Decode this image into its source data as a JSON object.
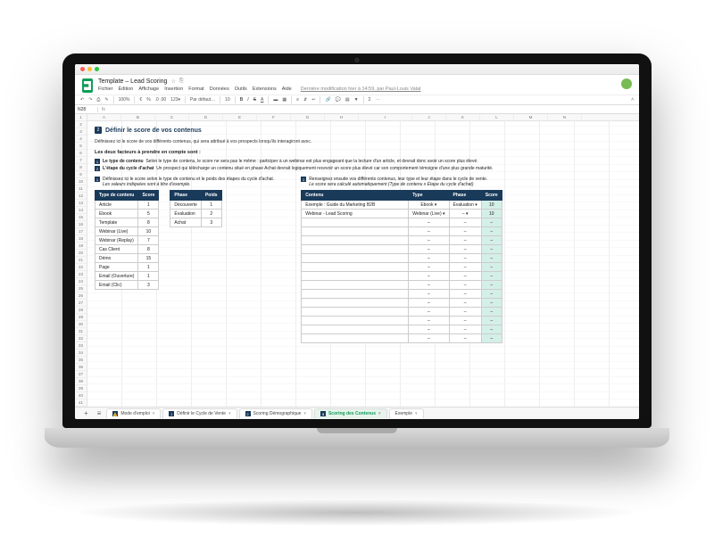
{
  "doc": {
    "title": "Template – Lead Scoring",
    "star_icon": "☆",
    "folder_icon": "⎘",
    "last_edit": "Dernière modification hier à 14:59, par Paul-Louis Valat",
    "namebox": "N28"
  },
  "menus": [
    "Fichier",
    "Édition",
    "Affichage",
    "Insertion",
    "Format",
    "Données",
    "Outils",
    "Extensions",
    "Aide"
  ],
  "toolbar": {
    "zoom": "100%",
    "currency": "€",
    "percent": "%",
    "decimals": ".0  .00",
    "format_menu": "123▾",
    "font": "Par défaut…",
    "font_size": "10",
    "bold": "B",
    "italic": "I",
    "strike": "S",
    "underline": "A"
  },
  "columns": [
    "A",
    "B",
    "C",
    "D",
    "E",
    "F",
    "G",
    "H",
    "I",
    "J",
    "K",
    "L",
    "M",
    "N"
  ],
  "section": {
    "badge": "2",
    "title": "Définir le score de vos contenus",
    "intro": "Définissez ici le score de vos différents contenus, qui sera attribué à vos prospects lorsqu'ils interagiront avec.",
    "subheading": "Les deux facteurs à prendre en compte sont :",
    "bullets": [
      {
        "n": "1",
        "b": "Le type de contenu",
        "t": "Selon le type de contenu, le score ne sera pas le même : participer à un webinar est plus engageant que la lecture d'un article, et devrait donc avoir un score plus élevé."
      },
      {
        "n": "2",
        "b": "L'étape du cycle d'achat",
        "t": "Un prospect qui télécharge un contenu situé en phase Achat devrait logiquement recevoir un score plus élevé car son comportement témoigne d'une plus grande maturité."
      }
    ],
    "left_panel": {
      "n": "1",
      "line1": "Définissez ici le score selon le type de contenu et le poids des étapes du cycle d'achat.",
      "line2": "Les valeurs indiquées sont à titre d'exemple."
    },
    "right_panel": {
      "n": "2",
      "line1": "Renseignez ensuite vos différents contenus, leur type et leur étape dans le cycle de vente.",
      "line2": "Le score sera calculé automatiquement (Type de contenu x Étape du cycle d'achat)"
    }
  },
  "table_type": {
    "headers": [
      "Type de contenu",
      "Score"
    ],
    "rows": [
      [
        "Article",
        "1"
      ],
      [
        "Ebook",
        "5"
      ],
      [
        "Template",
        "8"
      ],
      [
        "Webinar (Live)",
        "10"
      ],
      [
        "Webinar (Replay)",
        "7"
      ],
      [
        "Cas Client",
        "8"
      ],
      [
        "Démo",
        "15"
      ],
      [
        "Page",
        "1"
      ],
      [
        "Email (Ouverture)",
        "1"
      ],
      [
        "Email (Clic)",
        "3"
      ]
    ]
  },
  "table_phase": {
    "headers": [
      "Phase",
      "Poids"
    ],
    "rows": [
      [
        "Découverte",
        "1"
      ],
      [
        "Évaluation",
        "2"
      ],
      [
        "Achat",
        "3"
      ]
    ]
  },
  "table_content": {
    "headers": [
      "Contenu",
      "Type",
      "Phase",
      "Score"
    ],
    "rows": [
      [
        "Exemple : Guide du Marketing B2B",
        "Ebook ▾",
        "Évaluation ▾",
        "10"
      ],
      [
        "Webinar - Lead Scoring",
        "Webinar (Live) ▾",
        "– ▾",
        "10"
      ]
    ],
    "empty_rows": 14
  },
  "tabs": [
    {
      "icon": "⚠️",
      "label": "Mode d'emploi"
    },
    {
      "icon": "1",
      "label": "Définir le Cycle de Vente"
    },
    {
      "icon": "2",
      "label": "Scoring Démographique"
    },
    {
      "icon": "3",
      "label": "Scoring des Contenus",
      "active": true
    },
    {
      "icon": "",
      "label": "Exemple"
    }
  ]
}
